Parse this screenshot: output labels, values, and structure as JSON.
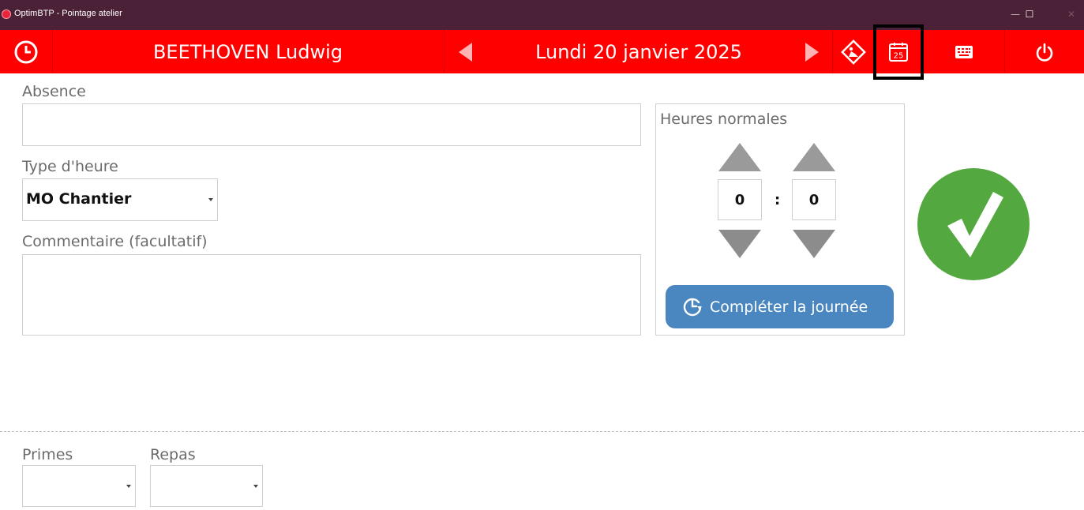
{
  "window": {
    "title": "OptimBTP - Pointage atelier",
    "minimize": "—",
    "maximize": "☐",
    "close": "✕"
  },
  "toolbar": {
    "employee": "BEETHOVEN Ludwig",
    "date": "Lundi 20 janvier 2025",
    "calendar_day": "25"
  },
  "form": {
    "absence_label": "Absence",
    "absence_value": "",
    "type_label": "Type d'heure",
    "type_value": "MO Chantier",
    "comment_label": "Commentaire (facultatif)",
    "comment_value": ""
  },
  "hours": {
    "label": "Heures normales",
    "hours": "0",
    "separator": ":",
    "minutes": "0",
    "complete_button": "Compléter la journée"
  },
  "bottom": {
    "primes_label": "Primes",
    "primes_value": "",
    "repas_label": "Repas",
    "repas_value": ""
  },
  "colors": {
    "toolbar": "#ff0000",
    "titlebar": "#4b2138",
    "validate": "#53a93f",
    "complete": "#4a86c0"
  }
}
